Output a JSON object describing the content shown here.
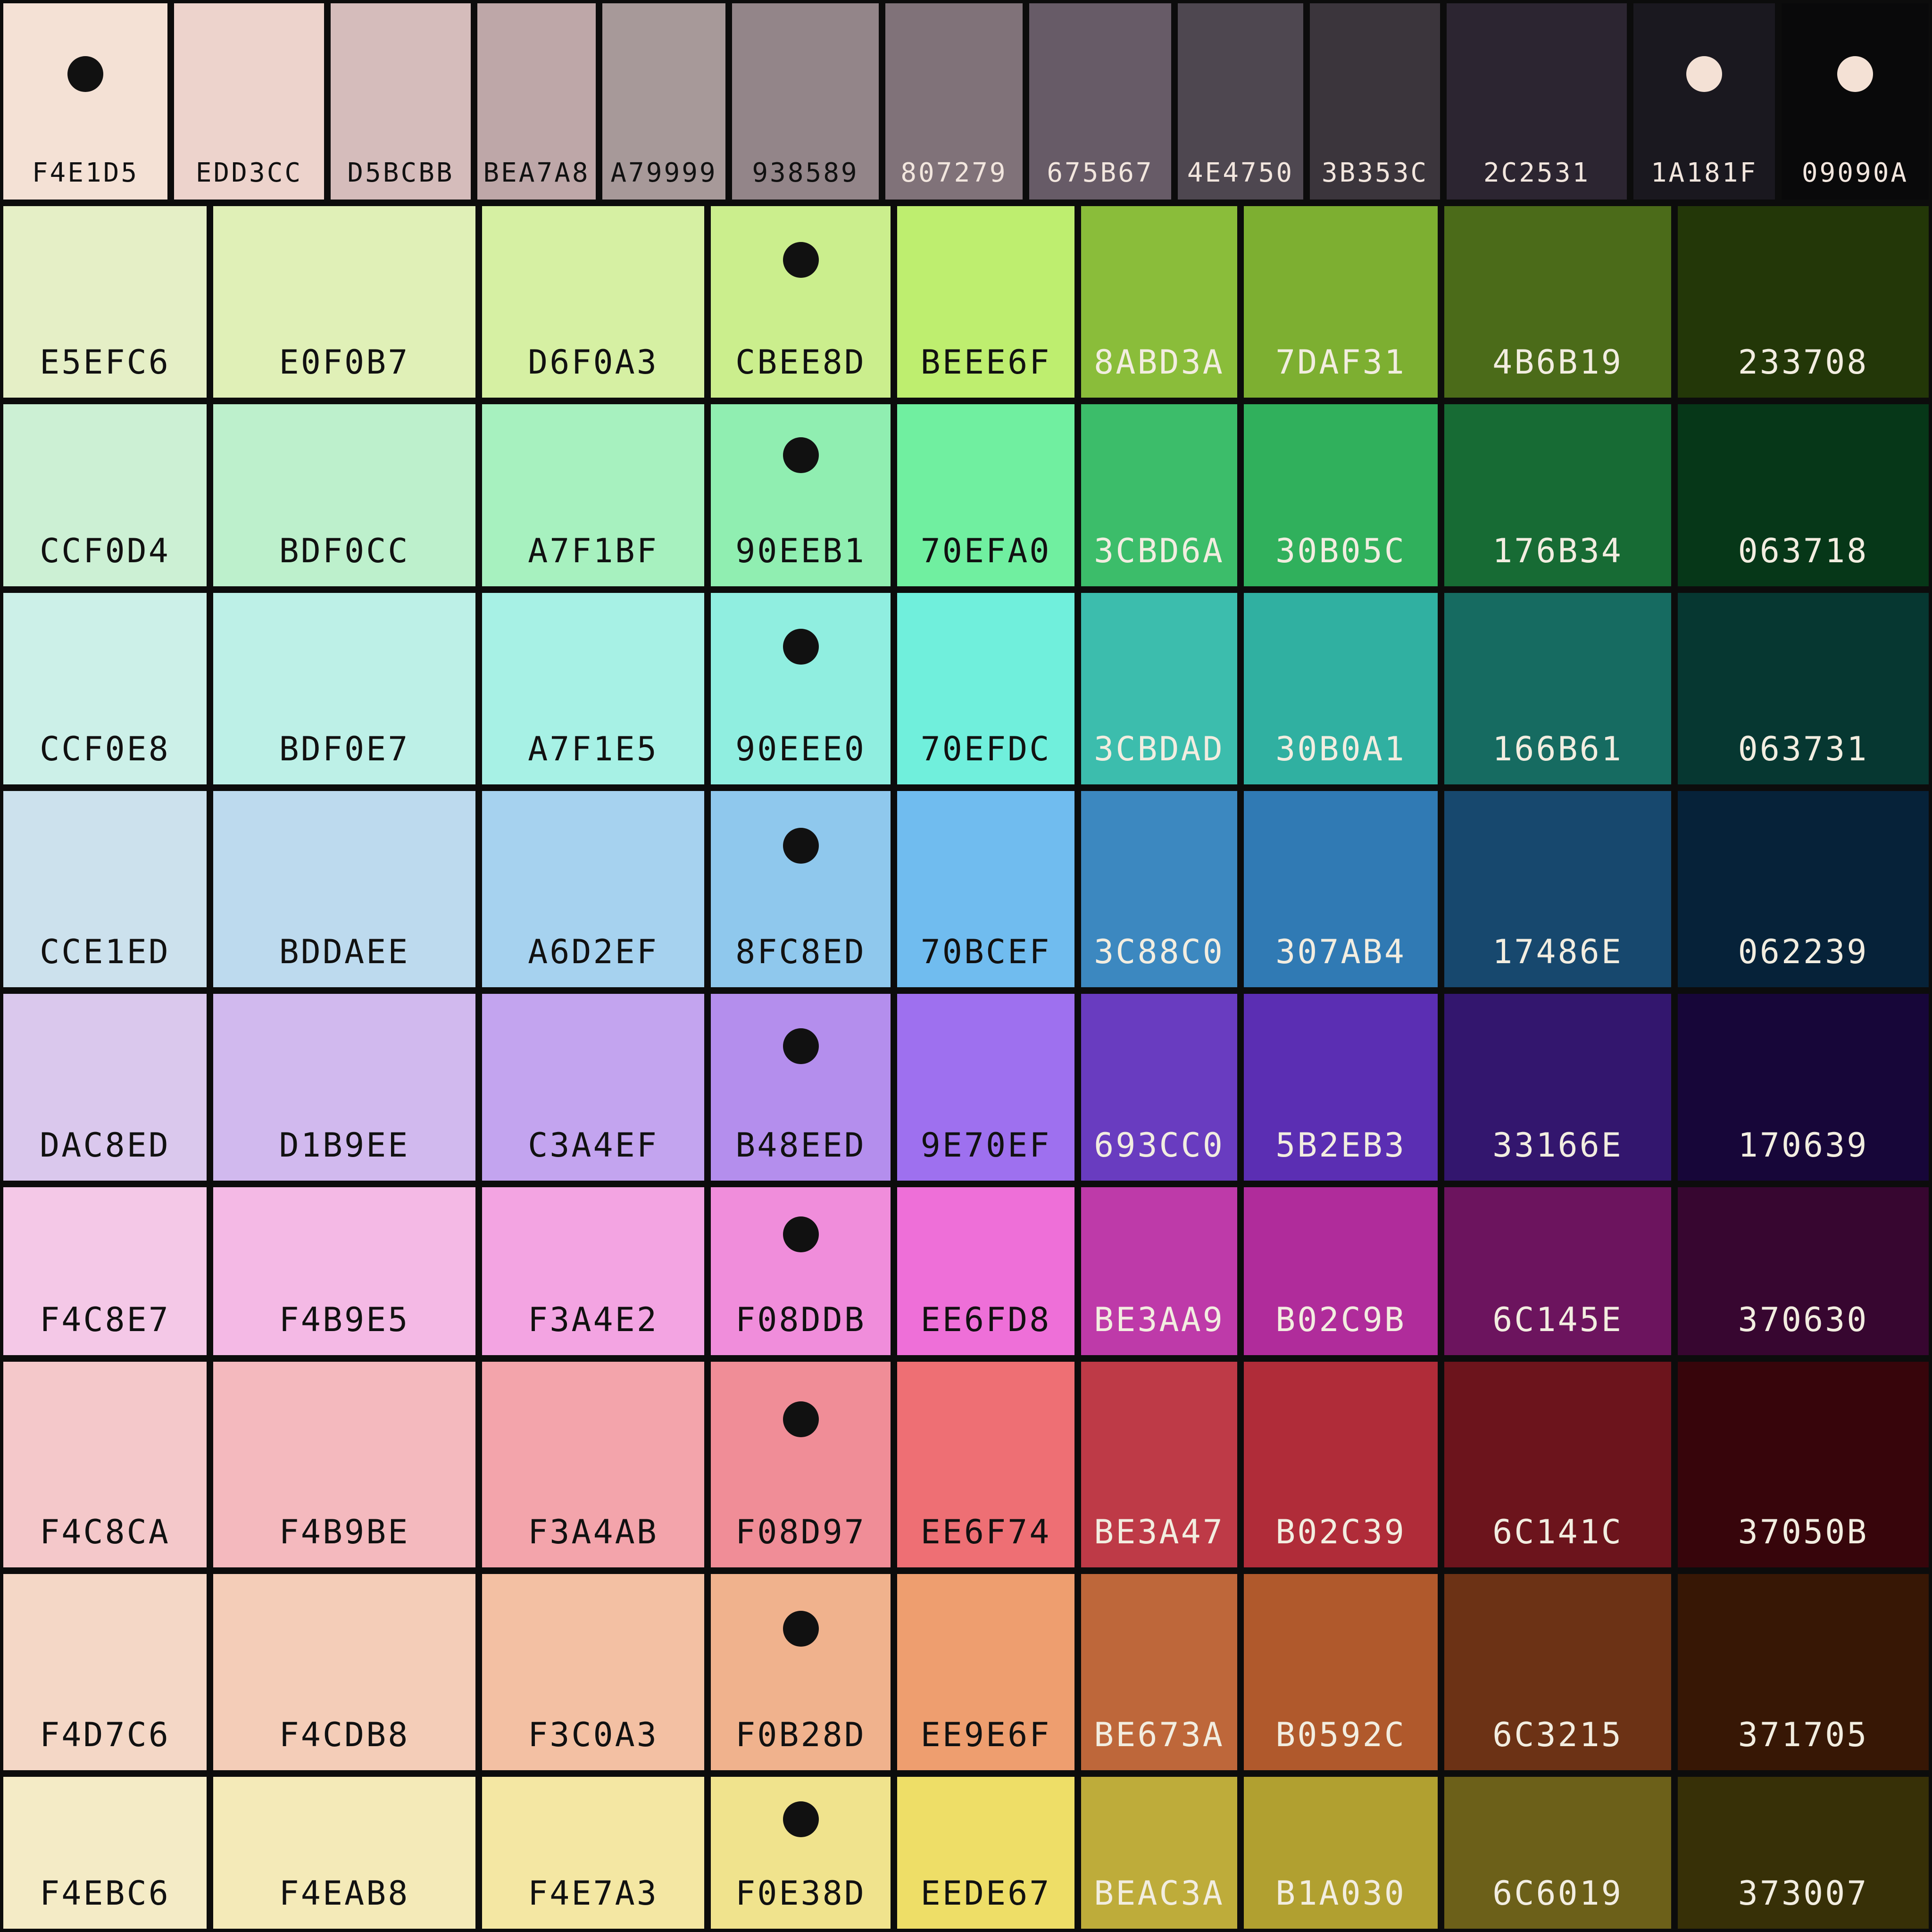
{
  "gray_row": {
    "swatches": [
      {
        "hex": "F4E1D5",
        "color": "#F4E1D5",
        "text": "#111111",
        "dot": "#111111"
      },
      {
        "hex": "EDD3CC",
        "color": "#EDD3CC",
        "text": "#111111"
      },
      {
        "hex": "D5BCBB",
        "color": "#D5BCBB",
        "text": "#111111"
      },
      {
        "hex": "BEA7A8",
        "color": "#BEA7A8",
        "text": "#111111"
      },
      {
        "hex": "A79999",
        "color": "#A79999",
        "text": "#111111"
      },
      {
        "hex": "938589",
        "color": "#938589",
        "text": "#111111"
      },
      {
        "hex": "807279",
        "color": "#807279",
        "text": "#F2E6DE"
      },
      {
        "hex": "675B67",
        "color": "#675B67",
        "text": "#F2E6DE"
      },
      {
        "hex": "4E4750",
        "color": "#4E4750",
        "text": "#F2E6DE"
      },
      {
        "hex": "3B353C",
        "color": "#3B353C",
        "text": "#F2E6DE"
      },
      {
        "hex": "2C2531",
        "color": "#2C2531",
        "text": "#F2E6DE"
      },
      {
        "hex": "1A181F",
        "color": "#1A181F",
        "text": "#F2E6DE",
        "dot": "#F4E1D5"
      },
      {
        "hex": "09090A",
        "color": "#09090A",
        "text": "#F2E6DE",
        "dot": "#F4E1D5"
      }
    ]
  },
  "color_rows": [
    {
      "swatches": [
        {
          "hex": "E5EFC6",
          "color": "#E5EFC6",
          "text": "#111111"
        },
        {
          "hex": "E0F0B7",
          "color": "#E0F0B7",
          "text": "#111111"
        },
        {
          "hex": "D6F0A3",
          "color": "#D6F0A3",
          "text": "#111111"
        },
        {
          "hex": "CBEE8D",
          "color": "#CBEE8D",
          "text": "#111111",
          "dot": "#111111"
        },
        {
          "hex": "BEEE6F",
          "color": "#BEEE6F",
          "text": "#111111"
        },
        {
          "hex": "8ABD3A",
          "color": "#8ABD3A",
          "text": "#F2EDE0"
        },
        {
          "hex": "7DAF31",
          "color": "#7DAF31",
          "text": "#F2EDE0"
        },
        {
          "hex": "4B6B19",
          "color": "#4B6B19",
          "text": "#F2EDE0"
        },
        {
          "hex": "233708",
          "color": "#233708",
          "text": "#F2EDE0"
        }
      ]
    },
    {
      "swatches": [
        {
          "hex": "CCF0D4",
          "color": "#CCF0D4",
          "text": "#111111"
        },
        {
          "hex": "BDF0CC",
          "color": "#BDF0CC",
          "text": "#111111"
        },
        {
          "hex": "A7F1BF",
          "color": "#A7F1BF",
          "text": "#111111"
        },
        {
          "hex": "90EEB1",
          "color": "#90EEB1",
          "text": "#111111",
          "dot": "#111111"
        },
        {
          "hex": "70EFA0",
          "color": "#70EFA0",
          "text": "#111111"
        },
        {
          "hex": "3CBD6A",
          "color": "#3CBD6A",
          "text": "#F2EDE0"
        },
        {
          "hex": "30B05C",
          "color": "#30B05C",
          "text": "#F2EDE0"
        },
        {
          "hex": "176B34",
          "color": "#176B34",
          "text": "#F2EDE0"
        },
        {
          "hex": "063718",
          "color": "#063718",
          "text": "#F2EDE0"
        }
      ]
    },
    {
      "swatches": [
        {
          "hex": "CCF0E8",
          "color": "#CCF0E8",
          "text": "#111111"
        },
        {
          "hex": "BDF0E7",
          "color": "#BDF0E7",
          "text": "#111111"
        },
        {
          "hex": "A7F1E5",
          "color": "#A7F1E5",
          "text": "#111111"
        },
        {
          "hex": "90EEE0",
          "color": "#90EEE0",
          "text": "#111111",
          "dot": "#111111"
        },
        {
          "hex": "70EFDC",
          "color": "#70EFDC",
          "text": "#111111"
        },
        {
          "hex": "3CBDAD",
          "color": "#3CBDAD",
          "text": "#F2EDE0"
        },
        {
          "hex": "30B0A1",
          "color": "#30B0A1",
          "text": "#F2EDE0"
        },
        {
          "hex": "166B61",
          "color": "#166B61",
          "text": "#F2EDE0"
        },
        {
          "hex": "063731",
          "color": "#063731",
          "text": "#F2EDE0"
        }
      ]
    },
    {
      "swatches": [
        {
          "hex": "CCE1ED",
          "color": "#CCE1ED",
          "text": "#111111"
        },
        {
          "hex": "BDDAEE",
          "color": "#BDDAEE",
          "text": "#111111"
        },
        {
          "hex": "A6D2EF",
          "color": "#A6D2EF",
          "text": "#111111"
        },
        {
          "hex": "8FC8ED",
          "color": "#8FC8ED",
          "text": "#111111",
          "dot": "#111111"
        },
        {
          "hex": "70BCEF",
          "color": "#70BCEF",
          "text": "#111111"
        },
        {
          "hex": "3C88C0",
          "color": "#3C88C0",
          "text": "#F2EDE0"
        },
        {
          "hex": "307AB4",
          "color": "#307AB4",
          "text": "#F2EDE0"
        },
        {
          "hex": "17486E",
          "color": "#17486E",
          "text": "#F2EDE0"
        },
        {
          "hex": "062239",
          "color": "#062239",
          "text": "#F2EDE0"
        }
      ]
    },
    {
      "swatches": [
        {
          "hex": "DAC8ED",
          "color": "#DAC8ED",
          "text": "#111111"
        },
        {
          "hex": "D1B9EE",
          "color": "#D1B9EE",
          "text": "#111111"
        },
        {
          "hex": "C3A4EF",
          "color": "#C3A4EF",
          "text": "#111111"
        },
        {
          "hex": "B48EED",
          "color": "#B48EED",
          "text": "#111111",
          "dot": "#111111"
        },
        {
          "hex": "9E70EF",
          "color": "#9E70EF",
          "text": "#111111"
        },
        {
          "hex": "693CC0",
          "color": "#693CC0",
          "text": "#F2EDE0"
        },
        {
          "hex": "5B2EB3",
          "color": "#5B2EB3",
          "text": "#F2EDE0"
        },
        {
          "hex": "33166E",
          "color": "#33166E",
          "text": "#F2EDE0"
        },
        {
          "hex": "170639",
          "color": "#170639",
          "text": "#F2EDE0"
        }
      ]
    },
    {
      "swatches": [
        {
          "hex": "F4C8E7",
          "color": "#F4C8E7",
          "text": "#111111"
        },
        {
          "hex": "F4B9E5",
          "color": "#F4B9E5",
          "text": "#111111"
        },
        {
          "hex": "F3A4E2",
          "color": "#F3A4E2",
          "text": "#111111"
        },
        {
          "hex": "F08DDB",
          "color": "#F08DDB",
          "text": "#111111",
          "dot": "#111111"
        },
        {
          "hex": "EE6FD8",
          "color": "#EE6FD8",
          "text": "#111111"
        },
        {
          "hex": "BE3AA9",
          "color": "#BE3AA9",
          "text": "#F2EDE0"
        },
        {
          "hex": "B02C9B",
          "color": "#B02C9B",
          "text": "#F2EDE0"
        },
        {
          "hex": "6C145E",
          "color": "#6C145E",
          "text": "#F2EDE0"
        },
        {
          "hex": "370630",
          "color": "#370630",
          "text": "#F2EDE0"
        }
      ]
    },
    {
      "swatches": [
        {
          "hex": "F4C8CA",
          "color": "#F4C8CA",
          "text": "#111111"
        },
        {
          "hex": "F4B9BE",
          "color": "#F4B9BE",
          "text": "#111111"
        },
        {
          "hex": "F3A4AB",
          "color": "#F3A4AB",
          "text": "#111111"
        },
        {
          "hex": "F08D97",
          "color": "#F08D97",
          "text": "#111111",
          "dot": "#111111"
        },
        {
          "hex": "EE6F74",
          "color": "#EE6F74",
          "text": "#111111"
        },
        {
          "hex": "BE3A47",
          "color": "#BE3A47",
          "text": "#F2EDE0"
        },
        {
          "hex": "B02C39",
          "color": "#B02C39",
          "text": "#F2EDE0"
        },
        {
          "hex": "6C141C",
          "color": "#6C141C",
          "text": "#F2EDE0"
        },
        {
          "hex": "37050B",
          "color": "#37050B",
          "text": "#F2EDE0"
        }
      ]
    },
    {
      "swatches": [
        {
          "hex": "F4D7C6",
          "color": "#F4D7C6",
          "text": "#111111"
        },
        {
          "hex": "F4CDB8",
          "color": "#F4CDB8",
          "text": "#111111"
        },
        {
          "hex": "F3C0A3",
          "color": "#F3C0A3",
          "text": "#111111"
        },
        {
          "hex": "F0B28D",
          "color": "#F0B28D",
          "text": "#111111",
          "dot": "#111111"
        },
        {
          "hex": "EE9E6F",
          "color": "#EE9E6F",
          "text": "#111111"
        },
        {
          "hex": "BE673A",
          "color": "#BE673A",
          "text": "#F2EDE0"
        },
        {
          "hex": "B0592C",
          "color": "#B0592C",
          "text": "#F2EDE0"
        },
        {
          "hex": "6C3215",
          "color": "#6C3215",
          "text": "#F2EDE0"
        },
        {
          "hex": "371705",
          "color": "#371705",
          "text": "#F2EDE0"
        }
      ]
    },
    {
      "swatches": [
        {
          "hex": "F4EBC6",
          "color": "#F4EBC6",
          "text": "#111111"
        },
        {
          "hex": "F4EAB8",
          "color": "#F4EAB8",
          "text": "#111111"
        },
        {
          "hex": "F4E7A3",
          "color": "#F4E7A3",
          "text": "#111111"
        },
        {
          "hex": "F0E38D",
          "color": "#F0E38D",
          "text": "#111111",
          "dot": "#111111"
        },
        {
          "hex": "EEDE67",
          "color": "#EEDE67",
          "text": "#111111"
        },
        {
          "hex": "BEAC3A",
          "color": "#BEAC3A",
          "text": "#F2EDE0"
        },
        {
          "hex": "B1A030",
          "color": "#B1A030",
          "text": "#F2EDE0"
        },
        {
          "hex": "6C6019",
          "color": "#6C6019",
          "text": "#F2EDE0"
        },
        {
          "hex": "373007",
          "color": "#373007",
          "text": "#F2EDE0"
        }
      ]
    }
  ]
}
